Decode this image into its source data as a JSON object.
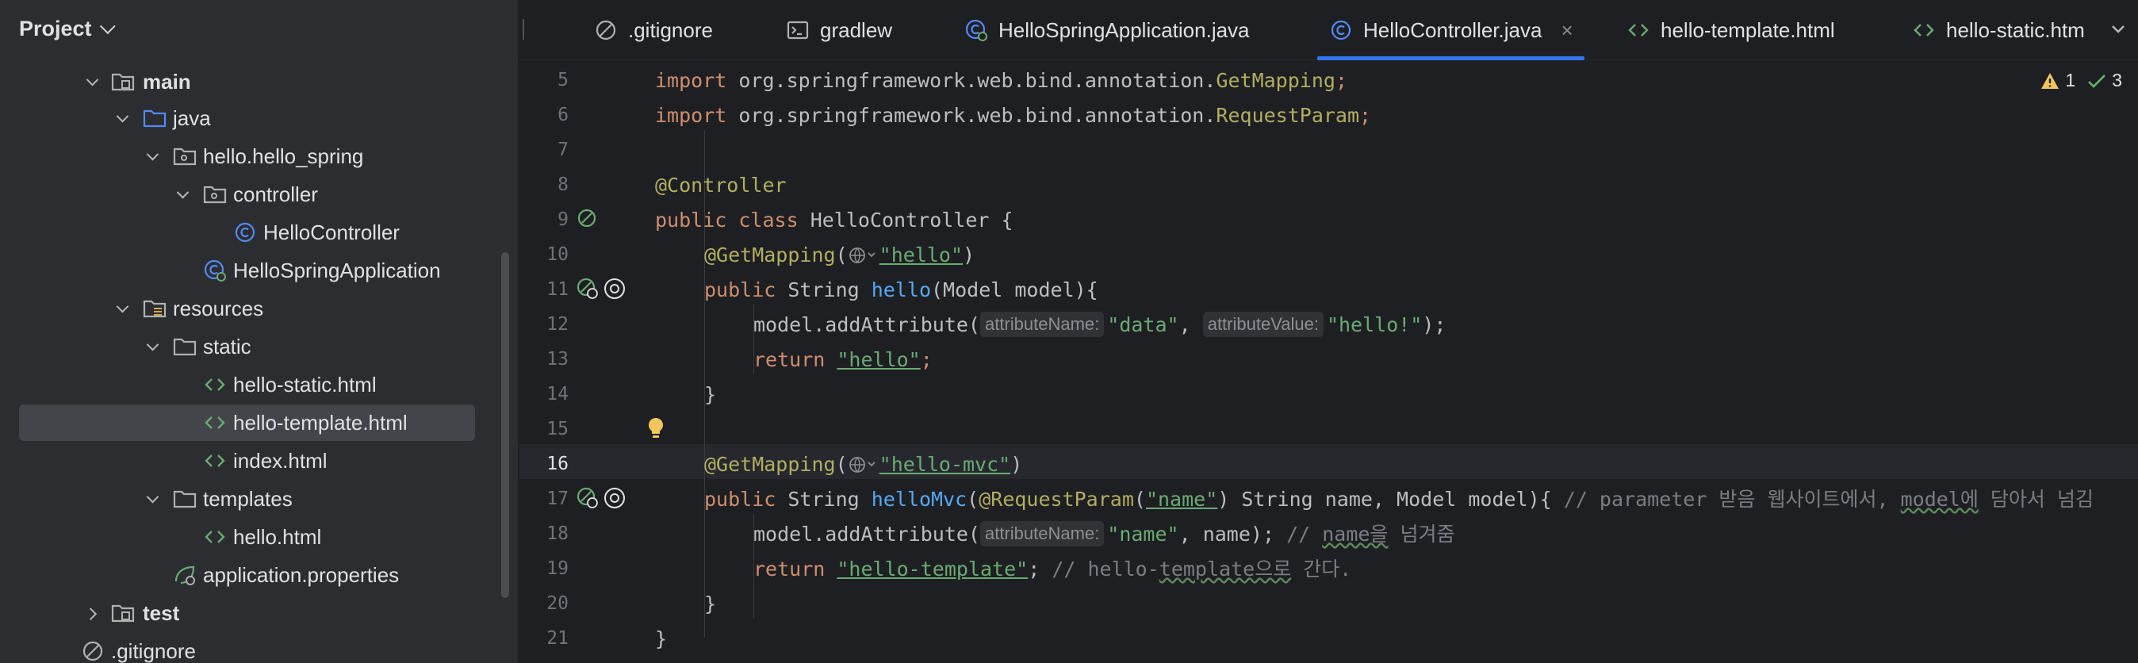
{
  "project_panel": {
    "title": "Project",
    "tree": [
      {
        "label": "main",
        "bold": true,
        "icon": "source-folder-icon",
        "expanded": true
      },
      {
        "label": "java",
        "icon": "java-source-root-icon",
        "expanded": true
      },
      {
        "label": "hello.hello_spring",
        "icon": "package-icon",
        "expanded": true
      },
      {
        "label": "controller",
        "icon": "package-icon",
        "expanded": true
      },
      {
        "label": "HelloController",
        "icon": "class-icon"
      },
      {
        "label": "HelloSpringApplication",
        "icon": "spring-boot-class-icon"
      },
      {
        "label": "resources",
        "icon": "resources-root-icon",
        "expanded": true
      },
      {
        "label": "static",
        "icon": "folder-icon",
        "expanded": true
      },
      {
        "label": "hello-static.html",
        "icon": "html-icon"
      },
      {
        "label": "hello-template.html",
        "icon": "html-icon",
        "selected": true
      },
      {
        "label": "index.html",
        "icon": "html-icon"
      },
      {
        "label": "templates",
        "icon": "folder-icon",
        "expanded": true
      },
      {
        "label": "hello.html",
        "icon": "html-icon"
      },
      {
        "label": "application.properties",
        "icon": "spring-properties-icon"
      },
      {
        "label": "test",
        "bold": true,
        "icon": "test-folder-icon",
        "expanded": false
      },
      {
        "label": ".gitignore",
        "icon": "gitignore-icon"
      }
    ]
  },
  "tabs": [
    {
      "label": ".gitignore",
      "icon": "gitignore-icon"
    },
    {
      "label": "gradlew",
      "icon": "terminal-icon"
    },
    {
      "label": "HelloSpringApplication.java",
      "icon": "spring-boot-class-icon"
    },
    {
      "label": "HelloController.java",
      "icon": "class-icon",
      "active": true,
      "close": "×"
    },
    {
      "label": "hello-template.html",
      "icon": "html-icon"
    },
    {
      "label": "hello-static.htm",
      "icon": "html-icon"
    }
  ],
  "inspections": {
    "warnings": "1",
    "ok": "3"
  },
  "editor": {
    "current_line": 16,
    "line_numbers": [
      "5",
      "6",
      "7",
      "8",
      "9",
      "10",
      "11",
      "12",
      "13",
      "14",
      "15",
      "16",
      "17",
      "18",
      "19",
      "20",
      "21"
    ],
    "code": {
      "l5": {
        "kw": "import",
        "pkg": " org.springframework.web.bind.annotation.",
        "cls": "GetMapping",
        "end": ";"
      },
      "l6": {
        "kw": "import",
        "pkg": " org.springframework.web.bind.annotation.",
        "cls": "RequestParam",
        "end": ";"
      },
      "l8": {
        "ann": "@Controller"
      },
      "l9": {
        "kw1": "public",
        "kw2": "class",
        "name": " HelloController {"
      },
      "l10": {
        "ann": "@GetMapping",
        "open": "(",
        "str": "\"hello\"",
        "close": ")"
      },
      "l11": {
        "kw": "public",
        "type": " String ",
        "fn": "hello",
        "rest": "(Model model){"
      },
      "l12": {
        "call": "model.addAttribute(",
        "hint1": "attributeName:",
        "str1": "\"data\"",
        "sep": ", ",
        "hint2": "attributeValue:",
        "str2": "\"hello!\"",
        "end": ");"
      },
      "l13": {
        "kw": "return",
        "str": "\"hello\"",
        "end": ";"
      },
      "l14": {
        "brace": "}"
      },
      "l16": {
        "ann": "@GetMapping",
        "open": "(",
        "str": "\"hello-mvc\"",
        "close": ")"
      },
      "l17": {
        "kw": "public",
        "type": " String ",
        "fn": "helloMvc",
        "open": "(",
        "ann": "@RequestParam",
        "p_open": "(",
        "str": "\"name\"",
        "rest": ") String name, Model model){ ",
        "comment_a": "// parameter 받음 웹사이트에서, ",
        "comment_u": "model에",
        "comment_b": " 담아서 넘김"
      },
      "l18": {
        "call": "model.addAttribute(",
        "hint": "attributeName:",
        "str": "\"name\"",
        "rest": ", name); ",
        "comment_a": "// ",
        "comment_u": "name을",
        "comment_b": " 넘겨줌"
      },
      "l19": {
        "kw": "return",
        "str": "\"hello-template\"",
        "rest": "; ",
        "comment_a": "// hello-",
        "comment_u": "template으로",
        "comment_b": " 간다."
      },
      "l20": {
        "brace": "}"
      },
      "l21": {
        "brace": "}"
      }
    }
  }
}
